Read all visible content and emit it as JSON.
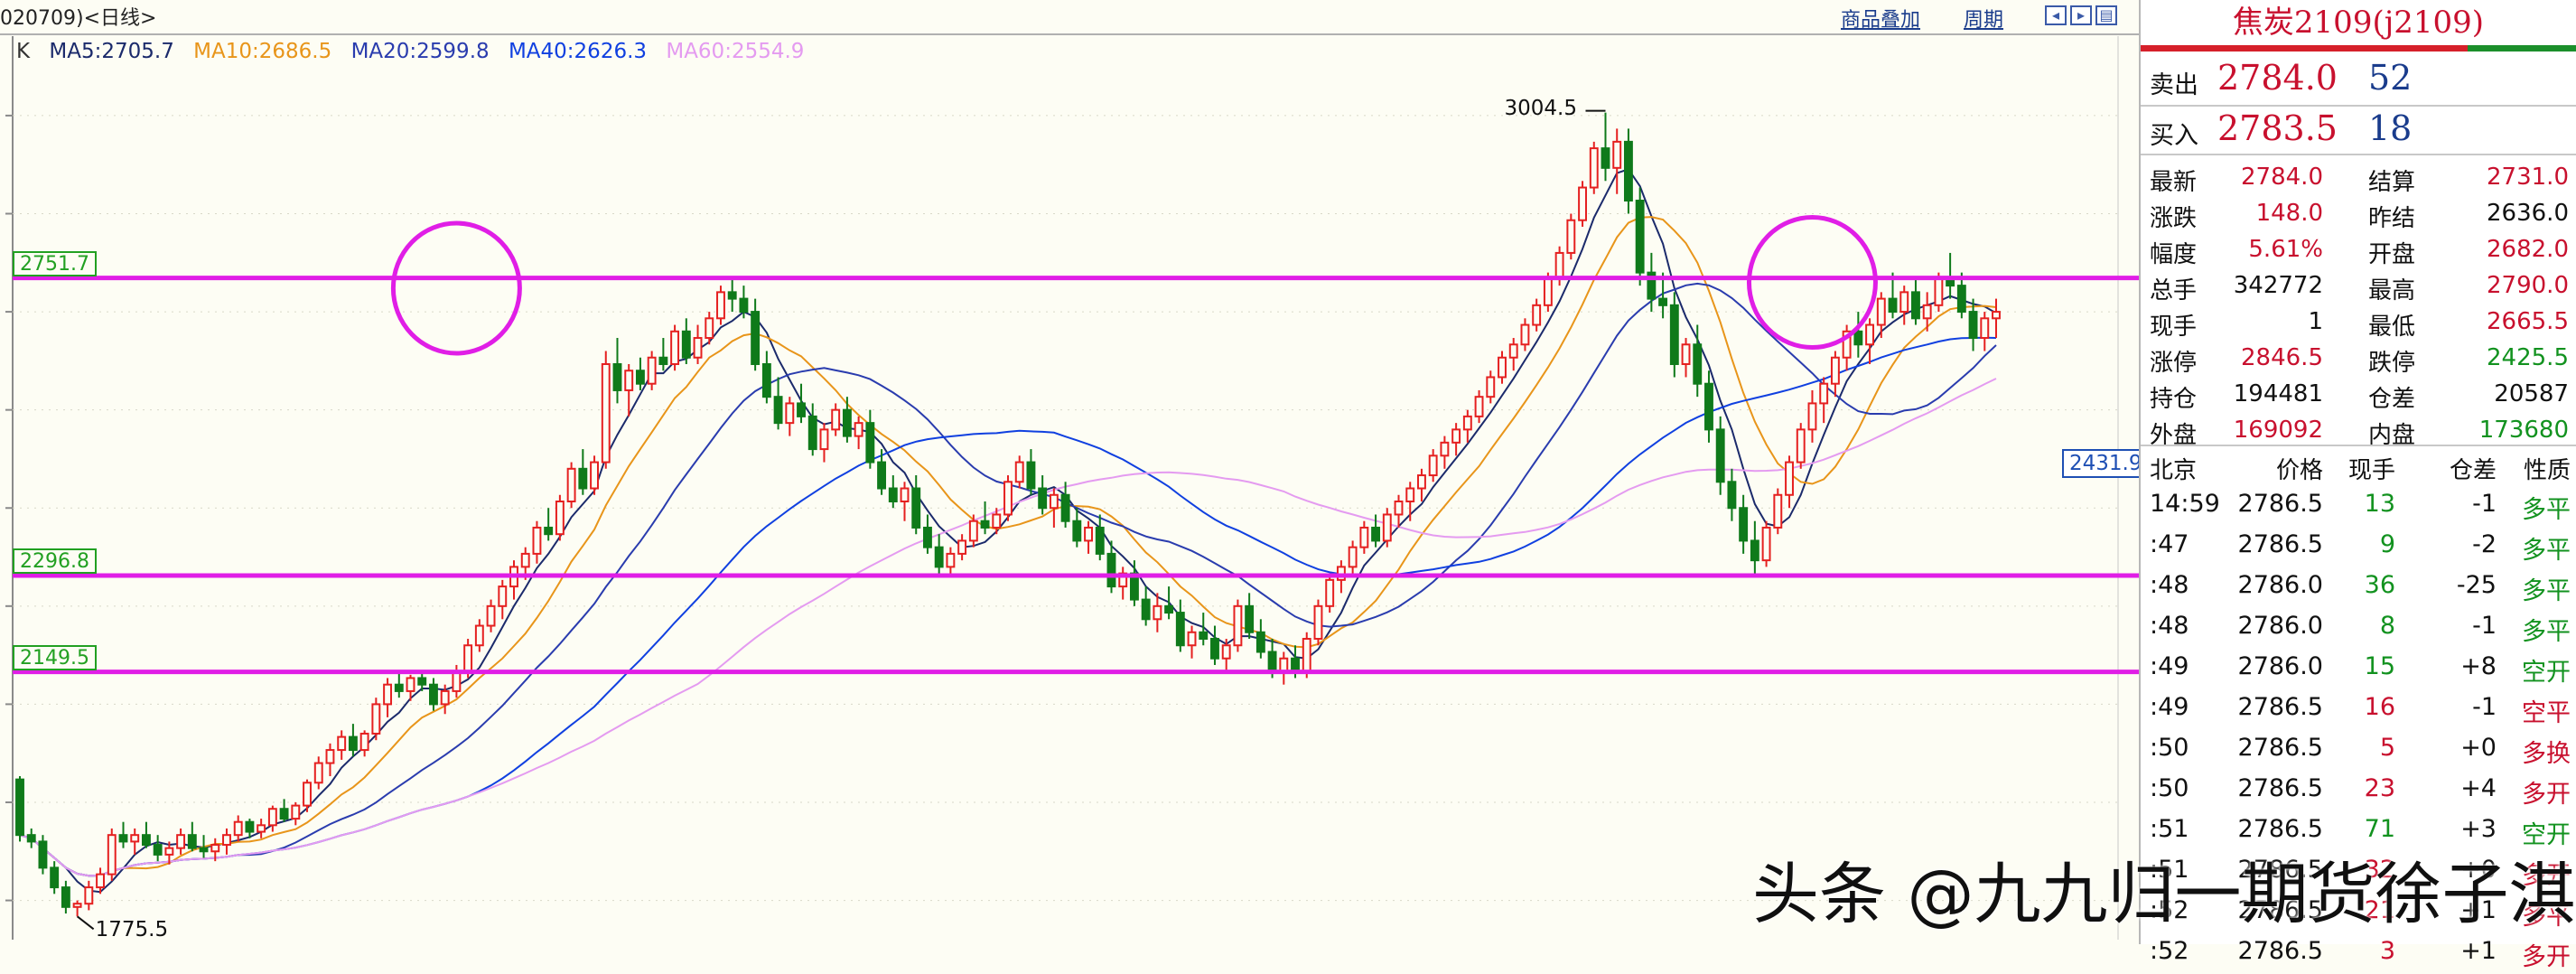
{
  "header": {
    "title": "020709)<日线>",
    "overlay_link": "商品叠加",
    "period_link": "周期"
  },
  "ma_legend": {
    "k_label": "K",
    "items": [
      {
        "text": "MA5:2705.7",
        "color": "#1b2a6b"
      },
      {
        "text": "MA10:2686.5",
        "color": "#e8951a"
      },
      {
        "text": "MA20:2599.8",
        "color": "#2a3cae"
      },
      {
        "text": "MA40:2626.3",
        "color": "#1040e0"
      },
      {
        "text": "MA60:2554.9",
        "color": "#e49bf0"
      }
    ]
  },
  "levels": [
    {
      "value": "2751.7",
      "price": 2751.7
    },
    {
      "value": "2296.8",
      "price": 2296.8
    },
    {
      "value": "2149.5",
      "price": 2149.5
    }
  ],
  "annotations": {
    "high_label": "3004.5",
    "low_label": "1775.5",
    "right_tag": "2431.9"
  },
  "colors": {
    "level_line": "#e01ee6",
    "circle": "#e01ee6",
    "up_candle": "#e52020",
    "down_candle": "#0f7a1a",
    "tag_border": "#22a022"
  },
  "chart_data": {
    "type": "candlestick",
    "title": "",
    "ylim": [
      1740,
      3080
    ],
    "horizontal_levels": [
      2751.7,
      2296.8,
      2149.5
    ],
    "highlight_circles": [
      {
        "candle_index": 38,
        "price": 2736
      },
      {
        "candle_index": 156,
        "price": 2745
      }
    ],
    "ohlc": [
      [
        1985.0,
        1990.0,
        1890.0,
        1900.0
      ],
      [
        1900.0,
        1910.0,
        1880.0,
        1890.0
      ],
      [
        1890.0,
        1900.0,
        1840.0,
        1850.0
      ],
      [
        1850.0,
        1860.0,
        1810.0,
        1820.0
      ],
      [
        1820.0,
        1830.0,
        1780.0,
        1790.0
      ],
      [
        1790.0,
        1800.0,
        1775.5,
        1795.0
      ],
      [
        1795.0,
        1830.0,
        1785.0,
        1820.0
      ],
      [
        1820.0,
        1850.0,
        1810.0,
        1840.0
      ],
      [
        1840.0,
        1910.0,
        1830.0,
        1900.0
      ],
      [
        1900.0,
        1920.0,
        1880.0,
        1890.0
      ],
      [
        1890.0,
        1910.0,
        1870.0,
        1900.0
      ],
      [
        1900.0,
        1920.0,
        1880.0,
        1885.0
      ],
      [
        1885.0,
        1900.0,
        1860.0,
        1870.0
      ],
      [
        1870.0,
        1890.0,
        1855.0,
        1880.0
      ],
      [
        1880.0,
        1910.0,
        1870.0,
        1900.0
      ],
      [
        1900.0,
        1920.0,
        1875.0,
        1880.0
      ],
      [
        1880.0,
        1900.0,
        1865.0,
        1875.0
      ],
      [
        1875.0,
        1895.0,
        1860.0,
        1885.0
      ],
      [
        1885.0,
        1910.0,
        1870.0,
        1900.0
      ],
      [
        1900.0,
        1930.0,
        1890.0,
        1920.0
      ],
      [
        1920.0,
        1925.0,
        1895.0,
        1905.0
      ],
      [
        1905.0,
        1925.0,
        1895.0,
        1915.0
      ],
      [
        1915.0,
        1945.0,
        1905.0,
        1940.0
      ],
      [
        1940.0,
        1955.0,
        1920.0,
        1925.0
      ],
      [
        1925.0,
        1950.0,
        1915.0,
        1945.0
      ],
      [
        1945.0,
        1985.0,
        1935.0,
        1980.0
      ],
      [
        1980.0,
        2020.0,
        1970.0,
        2010.0
      ],
      [
        2010.0,
        2040.0,
        1990.0,
        2030.0
      ],
      [
        2030.0,
        2060.0,
        2015.0,
        2050.0
      ],
      [
        2050.0,
        2070.0,
        2020.0,
        2030.0
      ],
      [
        2030.0,
        2060.0,
        2020.0,
        2055.0
      ],
      [
        2055.0,
        2110.0,
        2045.0,
        2100.0
      ],
      [
        2100.0,
        2140.0,
        2080.0,
        2130.0
      ],
      [
        2130.0,
        2150.0,
        2110.0,
        2120.0
      ],
      [
        2120.0,
        2145.0,
        2105.0,
        2140.0
      ],
      [
        2140.0,
        2150.0,
        2120.0,
        2130.0
      ],
      [
        2130.0,
        2140.0,
        2090.0,
        2100.0
      ],
      [
        2100.0,
        2130.0,
        2085.0,
        2120.0
      ],
      [
        2120.0,
        2160.0,
        2110.0,
        2150.0
      ],
      [
        2150.0,
        2200.0,
        2140.0,
        2190.0
      ],
      [
        2190.0,
        2230.0,
        2180.0,
        2220.0
      ],
      [
        2220.0,
        2260.0,
        2210.0,
        2250.0
      ],
      [
        2250.0,
        2290.0,
        2230.0,
        2280.0
      ],
      [
        2280.0,
        2320.0,
        2260.0,
        2310.0
      ],
      [
        2310.0,
        2340.0,
        2290.0,
        2330.0
      ],
      [
        2330.0,
        2380.0,
        2315.0,
        2370.0
      ],
      [
        2370.0,
        2400.0,
        2350.0,
        2360.0
      ],
      [
        2360.0,
        2420.0,
        2350.0,
        2410.0
      ],
      [
        2410.0,
        2470.0,
        2400.0,
        2460.0
      ],
      [
        2460.0,
        2490.0,
        2420.0,
        2430.0
      ],
      [
        2430.0,
        2480.0,
        2420.0,
        2470.0
      ],
      [
        2470.0,
        2640.0,
        2460.0,
        2620.0
      ],
      [
        2620.0,
        2660.0,
        2560.0,
        2580.0
      ],
      [
        2580.0,
        2620.0,
        2540.0,
        2610.0
      ],
      [
        2610.0,
        2630.0,
        2580.0,
        2590.0
      ],
      [
        2590.0,
        2640.0,
        2580.0,
        2630.0
      ],
      [
        2630.0,
        2660.0,
        2610.0,
        2620.0
      ],
      [
        2620.0,
        2680.0,
        2610.0,
        2670.0
      ],
      [
        2670.0,
        2690.0,
        2620.0,
        2630.0
      ],
      [
        2630.0,
        2680.0,
        2620.0,
        2660.0
      ],
      [
        2660.0,
        2700.0,
        2650.0,
        2690.0
      ],
      [
        2690.0,
        2740.0,
        2680.0,
        2730.0
      ],
      [
        2730.0,
        2751.7,
        2700.0,
        2720.0
      ],
      [
        2720.0,
        2740.0,
        2690.0,
        2700.0
      ],
      [
        2700.0,
        2720.0,
        2610.0,
        2620.0
      ],
      [
        2620.0,
        2640.0,
        2560.0,
        2570.0
      ],
      [
        2570.0,
        2600.0,
        2520.0,
        2530.0
      ],
      [
        2530.0,
        2570.0,
        2510.0,
        2560.0
      ],
      [
        2560.0,
        2590.0,
        2530.0,
        2540.0
      ],
      [
        2540.0,
        2560.0,
        2480.0,
        2490.0
      ],
      [
        2490.0,
        2530.0,
        2470.0,
        2520.0
      ],
      [
        2520.0,
        2560.0,
        2510.0,
        2550.0
      ],
      [
        2550.0,
        2570.0,
        2500.0,
        2510.0
      ],
      [
        2510.0,
        2540.0,
        2490.0,
        2530.0
      ],
      [
        2530.0,
        2550.0,
        2460.0,
        2470.0
      ],
      [
        2470.0,
        2490.0,
        2420.0,
        2430.0
      ],
      [
        2430.0,
        2450.0,
        2400.0,
        2410.0
      ],
      [
        2410.0,
        2440.0,
        2380.0,
        2430.0
      ],
      [
        2430.0,
        2450.0,
        2360.0,
        2370.0
      ],
      [
        2370.0,
        2390.0,
        2330.0,
        2340.0
      ],
      [
        2340.0,
        2360.0,
        2296.8,
        2310.0
      ],
      [
        2310.0,
        2340.0,
        2300.0,
        2330.0
      ],
      [
        2330.0,
        2360.0,
        2320.0,
        2350.0
      ],
      [
        2350.0,
        2390.0,
        2340.0,
        2380.0
      ],
      [
        2380.0,
        2410.0,
        2360.0,
        2370.0
      ],
      [
        2370.0,
        2400.0,
        2360.0,
        2390.0
      ],
      [
        2390.0,
        2450.0,
        2380.0,
        2440.0
      ],
      [
        2440.0,
        2480.0,
        2430.0,
        2470.0
      ],
      [
        2470.0,
        2490.0,
        2420.0,
        2430.0
      ],
      [
        2430.0,
        2450.0,
        2390.0,
        2400.0
      ],
      [
        2400.0,
        2430.0,
        2370.0,
        2420.0
      ],
      [
        2420.0,
        2440.0,
        2370.0,
        2380.0
      ],
      [
        2380.0,
        2400.0,
        2340.0,
        2350.0
      ],
      [
        2350.0,
        2380.0,
        2330.0,
        2370.0
      ],
      [
        2370.0,
        2390.0,
        2320.0,
        2330.0
      ],
      [
        2330.0,
        2350.0,
        2270.0,
        2280.0
      ],
      [
        2280.0,
        2310.0,
        2260.0,
        2300.0
      ],
      [
        2300.0,
        2320.0,
        2250.0,
        2260.0
      ],
      [
        2260.0,
        2280.0,
        2220.0,
        2230.0
      ],
      [
        2230.0,
        2270.0,
        2210.0,
        2250.0
      ],
      [
        2250.0,
        2280.0,
        2230.0,
        2240.0
      ],
      [
        2240.0,
        2260.0,
        2180.0,
        2190.0
      ],
      [
        2190.0,
        2220.0,
        2170.0,
        2210.0
      ],
      [
        2210.0,
        2240.0,
        2190.0,
        2200.0
      ],
      [
        2200.0,
        2220.0,
        2160.0,
        2170.0
      ],
      [
        2170.0,
        2200.0,
        2150.0,
        2190.0
      ],
      [
        2190.0,
        2260.0,
        2180.0,
        2250.0
      ],
      [
        2250.0,
        2270.0,
        2200.0,
        2210.0
      ],
      [
        2210.0,
        2230.0,
        2170.0,
        2180.0
      ],
      [
        2180.0,
        2200.0,
        2140.0,
        2150.0
      ],
      [
        2150.0,
        2180.0,
        2130.0,
        2170.0
      ],
      [
        2170.0,
        2190.0,
        2140.0,
        2150.0
      ],
      [
        2150.0,
        2210.0,
        2140.0,
        2200.0
      ],
      [
        2200.0,
        2260.0,
        2190.0,
        2250.0
      ],
      [
        2250.0,
        2300.0,
        2240.0,
        2290.0
      ],
      [
        2290.0,
        2320.0,
        2270.0,
        2310.0
      ],
      [
        2310.0,
        2350.0,
        2300.0,
        2340.0
      ],
      [
        2340.0,
        2380.0,
        2330.0,
        2370.0
      ],
      [
        2370.0,
        2390.0,
        2340.0,
        2350.0
      ],
      [
        2350.0,
        2400.0,
        2340.0,
        2390.0
      ],
      [
        2390.0,
        2420.0,
        2370.0,
        2410.0
      ],
      [
        2410.0,
        2440.0,
        2380.0,
        2430.0
      ],
      [
        2430.0,
        2460.0,
        2410.0,
        2450.0
      ],
      [
        2450.0,
        2490.0,
        2440.0,
        2480.0
      ],
      [
        2480.0,
        2510.0,
        2460.0,
        2500.0
      ],
      [
        2500.0,
        2530.0,
        2480.0,
        2520.0
      ],
      [
        2520.0,
        2550.0,
        2500.0,
        2540.0
      ],
      [
        2540.0,
        2580.0,
        2530.0,
        2570.0
      ],
      [
        2570.0,
        2610.0,
        2560.0,
        2600.0
      ],
      [
        2600.0,
        2640.0,
        2590.0,
        2630.0
      ],
      [
        2630.0,
        2660.0,
        2610.0,
        2650.0
      ],
      [
        2650.0,
        2690.0,
        2640.0,
        2680.0
      ],
      [
        2680.0,
        2720.0,
        2670.0,
        2710.0
      ],
      [
        2710.0,
        2760.0,
        2700.0,
        2750.0
      ],
      [
        2750.0,
        2800.0,
        2740.0,
        2790.0
      ],
      [
        2790.0,
        2850.0,
        2780.0,
        2840.0
      ],
      [
        2840.0,
        2900.0,
        2830.0,
        2890.0
      ],
      [
        2890.0,
        2960.0,
        2880.0,
        2950.0
      ],
      [
        2950.0,
        3004.5,
        2900.0,
        2920.0
      ],
      [
        2920.0,
        2980.0,
        2880.0,
        2960.0
      ],
      [
        2960.0,
        2980.0,
        2850.0,
        2870.0
      ],
      [
        2870.0,
        2890.0,
        2740.0,
        2760.0
      ],
      [
        2760.0,
        2790.0,
        2700.0,
        2720.0
      ],
      [
        2720.0,
        2760.0,
        2690.0,
        2710.0
      ],
      [
        2710.0,
        2730.0,
        2600.0,
        2620.0
      ],
      [
        2620.0,
        2660.0,
        2600.0,
        2650.0
      ],
      [
        2650.0,
        2680.0,
        2570.0,
        2590.0
      ],
      [
        2590.0,
        2610.0,
        2500.0,
        2520.0
      ],
      [
        2520.0,
        2540.0,
        2420.0,
        2440.0
      ],
      [
        2440.0,
        2460.0,
        2380.0,
        2400.0
      ],
      [
        2400.0,
        2420.0,
        2330.0,
        2350.0
      ],
      [
        2350.0,
        2380.0,
        2296.8,
        2320.0
      ],
      [
        2320.0,
        2380.0,
        2310.0,
        2370.0
      ],
      [
        2370.0,
        2430.0,
        2360.0,
        2420.0
      ],
      [
        2420.0,
        2480.0,
        2400.0,
        2470.0
      ],
      [
        2470.0,
        2530.0,
        2460.0,
        2520.0
      ],
      [
        2520.0,
        2580.0,
        2500.0,
        2560.0
      ],
      [
        2560.0,
        2600.0,
        2530.0,
        2590.0
      ],
      [
        2590.0,
        2640.0,
        2570.0,
        2630.0
      ],
      [
        2630.0,
        2680.0,
        2610.0,
        2670.0
      ],
      [
        2670.0,
        2700.0,
        2630.0,
        2650.0
      ],
      [
        2650.0,
        2690.0,
        2620.0,
        2680.0
      ],
      [
        2680.0,
        2730.0,
        2660.0,
        2720.0
      ],
      [
        2720.0,
        2760.0,
        2690.0,
        2700.0
      ],
      [
        2700.0,
        2740.0,
        2680.0,
        2730.0
      ],
      [
        2730.0,
        2750.0,
        2680.0,
        2690.0
      ],
      [
        2690.0,
        2730.0,
        2670.0,
        2710.0
      ],
      [
        2710.0,
        2760.0,
        2700.0,
        2750.0
      ],
      [
        2750.0,
        2790.0,
        2720.0,
        2740.0
      ],
      [
        2740.0,
        2760.0,
        2690.0,
        2700.0
      ],
      [
        2700.0,
        2720.0,
        2640.0,
        2660.0
      ],
      [
        2660.0,
        2700.0,
        2640.0,
        2690.0
      ],
      [
        2690.0,
        2720.0,
        2660.0,
        2700.0
      ]
    ],
    "moving_averages": [
      {
        "name": "MA5",
        "period": 5,
        "color": "#1b2a6b"
      },
      {
        "name": "MA10",
        "period": 10,
        "color": "#e8951a"
      },
      {
        "name": "MA20",
        "period": 20,
        "color": "#2a3cae"
      },
      {
        "name": "MA40",
        "period": 40,
        "color": "#1040e0"
      },
      {
        "name": "MA60",
        "period": 60,
        "color": "#e49bf0"
      }
    ]
  },
  "panel": {
    "title": "焦炭2109(j2109)",
    "ask": {
      "label": "卖出",
      "price": "2784.0",
      "vol": "52"
    },
    "bid": {
      "label": "买入",
      "price": "2783.5",
      "vol": "18"
    },
    "stats": [
      {
        "l1": "最新",
        "v1": "2784.0",
        "c1": "red",
        "l2": "结算",
        "v2": "2731.0",
        "c2": "red"
      },
      {
        "l1": "涨跌",
        "v1": "148.0",
        "c1": "red",
        "l2": "昨结",
        "v2": "2636.0",
        "c2": "black"
      },
      {
        "l1": "幅度",
        "v1": "5.61%",
        "c1": "red",
        "l2": "开盘",
        "v2": "2682.0",
        "c2": "red"
      },
      {
        "l1": "总手",
        "v1": "342772",
        "c1": "black",
        "l2": "最高",
        "v2": "2790.0",
        "c2": "red"
      },
      {
        "l1": "现手",
        "v1": "1",
        "c1": "black",
        "l2": "最低",
        "v2": "2665.5",
        "c2": "red"
      },
      {
        "l1": "涨停",
        "v1": "2846.5",
        "c1": "red",
        "l2": "跌停",
        "v2": "2425.5",
        "c2": "green"
      },
      {
        "l1": "持仓",
        "v1": "194481",
        "c1": "black",
        "l2": "仓差",
        "v2": "20587",
        "c2": "black"
      },
      {
        "l1": "外盘",
        "v1": "169092",
        "c1": "red",
        "l2": "内盘",
        "v2": "173680",
        "c2": "green"
      }
    ],
    "tick_header": {
      "time": "北京",
      "price": "价格",
      "vol": "现手",
      "diff": "仓差",
      "nature": "性质"
    },
    "ticks": [
      {
        "time": "14:59",
        "price": "2786.5",
        "vol": "13",
        "vc": "green",
        "diff": "-1",
        "nature": "多平",
        "nc": "green"
      },
      {
        "time": ":47",
        "price": "2786.5",
        "vol": "9",
        "vc": "green",
        "diff": "-2",
        "nature": "多平",
        "nc": "green"
      },
      {
        "time": ":48",
        "price": "2786.0",
        "vol": "36",
        "vc": "green",
        "diff": "-25",
        "nature": "多平",
        "nc": "green"
      },
      {
        "time": ":48",
        "price": "2786.0",
        "vol": "8",
        "vc": "green",
        "diff": "-1",
        "nature": "多平",
        "nc": "green"
      },
      {
        "time": ":49",
        "price": "2786.0",
        "vol": "15",
        "vc": "green",
        "diff": "+8",
        "nature": "空开",
        "nc": "green"
      },
      {
        "time": ":49",
        "price": "2786.5",
        "vol": "16",
        "vc": "red",
        "diff": "-1",
        "nature": "空平",
        "nc": "red"
      },
      {
        "time": ":50",
        "price": "2786.5",
        "vol": "5",
        "vc": "red",
        "diff": "+0",
        "nature": "多换",
        "nc": "red"
      },
      {
        "time": ":50",
        "price": "2786.5",
        "vol": "23",
        "vc": "red",
        "diff": "+4",
        "nature": "多开",
        "nc": "red"
      },
      {
        "time": ":51",
        "price": "2786.5",
        "vol": "71",
        "vc": "green",
        "diff": "+3",
        "nature": "空开",
        "nc": "green"
      },
      {
        "time": ":51",
        "price": "2786.5",
        "vol": "32",
        "vc": "red",
        "diff": "+0",
        "nature": "多开",
        "nc": "red"
      },
      {
        "time": ":52",
        "price": "2786.5",
        "vol": "21",
        "vc": "red",
        "diff": "+1",
        "nature": "多平",
        "nc": "red"
      },
      {
        "time": ":52",
        "price": "2786.5",
        "vol": "3",
        "vc": "red",
        "diff": "+1",
        "nature": "多开",
        "nc": "red"
      }
    ]
  },
  "watermark": "头条 @九九归一期货徐子淇"
}
